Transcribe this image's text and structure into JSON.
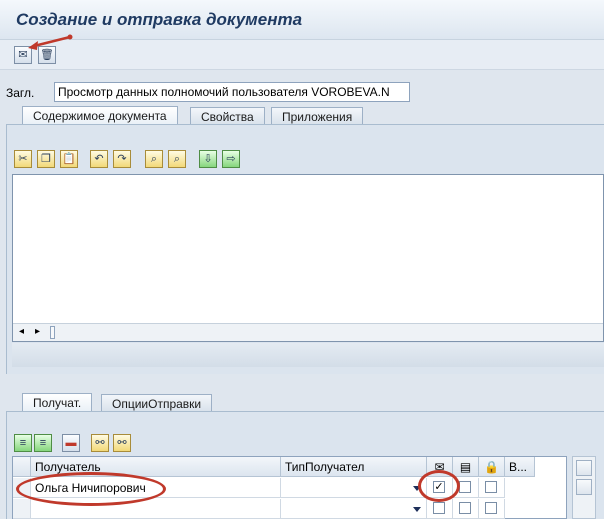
{
  "window": {
    "title": "Создание и отправка документа"
  },
  "subject": {
    "label": "Загл.",
    "value": "Просмотр данных полномочий пользователя VOROBEVA.N"
  },
  "doc_tabs": [
    {
      "label": "Содержимое документа",
      "active": true
    },
    {
      "label": "Свойства",
      "active": false
    },
    {
      "label": "Приложения",
      "active": false
    }
  ],
  "recipient_tabs": [
    {
      "label": "Получат.",
      "active": true
    },
    {
      "label": "ОпцииОтправки",
      "active": false
    }
  ],
  "grid": {
    "columns": {
      "recipient": "Получатель",
      "recipient_type": "ТипПолучател",
      "col_v": "В..."
    },
    "rows": [
      {
        "recipient": "Ольга Ничипорович",
        "recipient_type": "",
        "express": true,
        "copy": false,
        "blind": false
      },
      {
        "recipient": "",
        "recipient_type": "",
        "express": false,
        "copy": false,
        "blind": false
      }
    ]
  },
  "colors": {
    "annotation": "#c0392b",
    "title": "#1f3a62"
  }
}
